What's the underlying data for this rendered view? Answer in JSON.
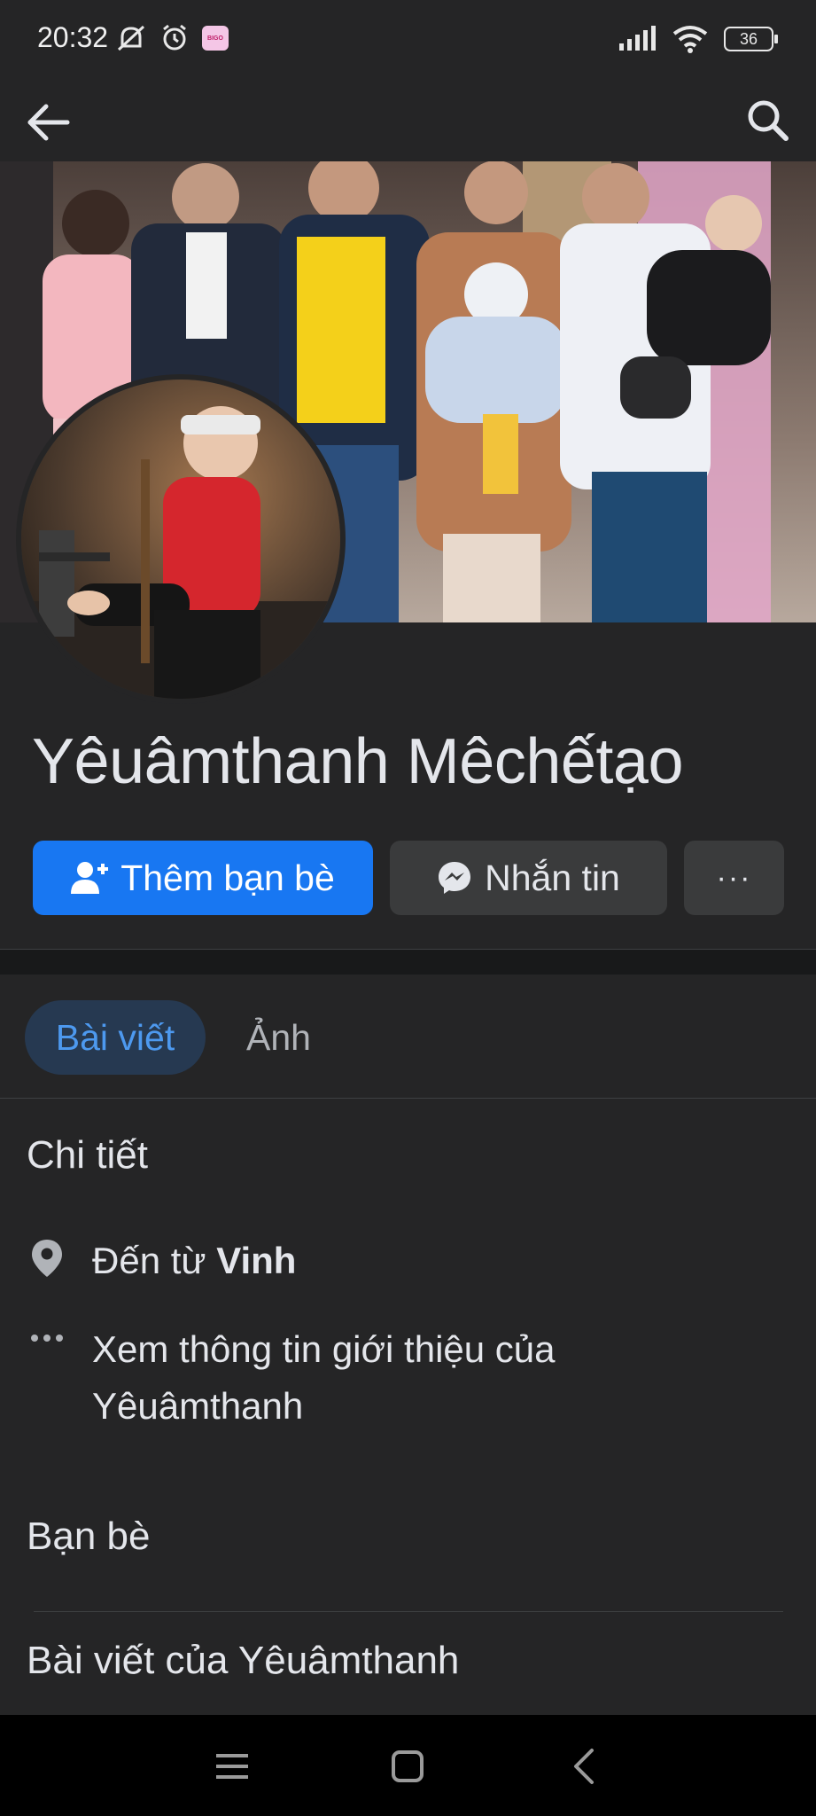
{
  "status_bar": {
    "time": "20:32",
    "app_badge": "BIGO",
    "battery": "36"
  },
  "profile": {
    "name": "Yêuâmthanh Mêchếtạo"
  },
  "actions": {
    "add_friend": "Thêm bạn bè",
    "message": "Nhắn tin",
    "more": "···"
  },
  "tabs": [
    {
      "label": "Bài viết",
      "active": true
    },
    {
      "label": "Ảnh",
      "active": false
    }
  ],
  "details": {
    "title": "Chi tiết",
    "from_prefix": "Đến từ",
    "from_place": "Vinh",
    "see_about": "Xem thông tin giới thiệu của",
    "see_about_name": "Yêuâmthanh"
  },
  "friends": {
    "title": "Bạn bè"
  },
  "posts": {
    "title": "Bài viết của Yêuâmthanh"
  },
  "colors": {
    "accent": "#1877f2",
    "background": "#252526",
    "tab_active_bg": "#263951",
    "tab_active_text": "#4d99ef"
  },
  "icons": {
    "back": "arrow-left-icon",
    "search": "search-icon",
    "add_friend": "person-add-icon",
    "messenger": "messenger-icon",
    "location": "location-pin-icon",
    "more": "more-dots-icon"
  }
}
